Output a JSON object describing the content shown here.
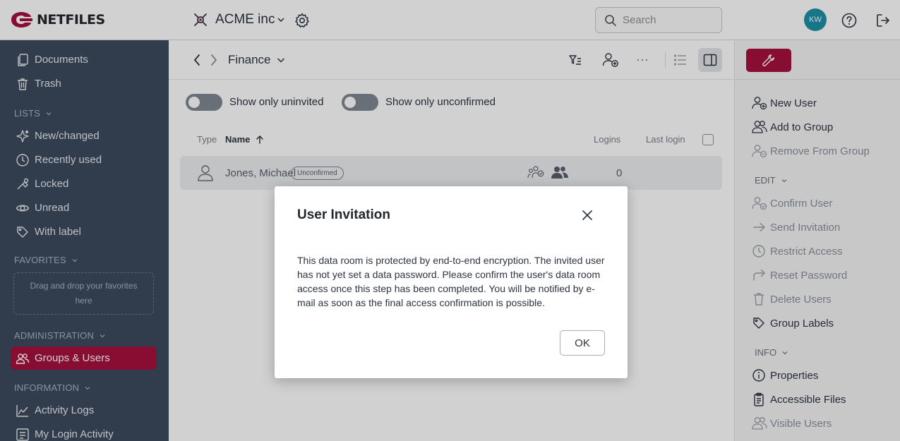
{
  "app": {
    "brand": "NETFILES",
    "workspace": "ACME inc",
    "brand_color": "#a7103f"
  },
  "search": {
    "placeholder": "Search"
  },
  "user": {
    "initials": "KW"
  },
  "sidebar": {
    "items_top": [
      {
        "label": "Documents",
        "icon": "documents-icon"
      },
      {
        "label": "Trash",
        "icon": "trash-icon"
      }
    ],
    "lists_title": "LISTS",
    "lists": [
      {
        "label": "New/changed",
        "icon": "sparkle-icon"
      },
      {
        "label": "Recently used",
        "icon": "clock-icon"
      },
      {
        "label": "Locked",
        "icon": "lock-icon"
      },
      {
        "label": "Unread",
        "icon": "eye-icon"
      },
      {
        "label": "With label",
        "icon": "tag-icon"
      }
    ],
    "favorites_title": "FAVORITES",
    "favorites_placeholder": "Drag and drop your favorites here",
    "administration_title": "ADMINISTRATION",
    "administration": [
      {
        "label": "Groups & Users",
        "icon": "users-icon",
        "active": true
      }
    ],
    "information_title": "INFORMATION",
    "information": [
      {
        "label": "Activity Logs",
        "icon": "chart-icon"
      },
      {
        "label": "My Login Activity",
        "icon": "list-icon"
      }
    ]
  },
  "main": {
    "breadcrumb": "Finance",
    "filters": [
      {
        "label": "Show only uninvited",
        "on": false
      },
      {
        "label": "Show only unconfirmed",
        "on": false
      }
    ],
    "columns": {
      "type": "Type",
      "name": "Name",
      "logins": "Logins",
      "last_login": "Last login"
    },
    "rows": [
      {
        "name": "Jones, Michael",
        "status": "Unconfirmed",
        "logins": "0",
        "last_login": ""
      }
    ]
  },
  "right_panel": {
    "actions": [
      {
        "label": "New User",
        "icon": "add-user-icon",
        "enabled": true
      },
      {
        "label": "Add to Group",
        "icon": "users-icon",
        "enabled": true
      },
      {
        "label": "Remove From Group",
        "icon": "remove-group-icon",
        "enabled": false
      }
    ],
    "edit_title": "EDIT",
    "edit": [
      {
        "label": "Confirm User",
        "icon": "confirm-user-icon",
        "enabled": false
      },
      {
        "label": "Send Invitation",
        "icon": "arrow-right-icon",
        "enabled": false
      },
      {
        "label": "Restrict Access",
        "icon": "clock-icon",
        "enabled": false
      },
      {
        "label": "Reset Password",
        "icon": "share-arrow-icon",
        "enabled": false
      },
      {
        "label": "Delete Users",
        "icon": "trash-icon",
        "enabled": false
      },
      {
        "label": "Group Labels",
        "icon": "tag-icon",
        "enabled": true
      }
    ],
    "info_title": "INFO",
    "info": [
      {
        "label": "Properties",
        "icon": "info-icon",
        "enabled": true
      },
      {
        "label": "Accessible Files",
        "icon": "clipboard-icon",
        "enabled": true
      },
      {
        "label": "Visible Users",
        "icon": "users-icon",
        "enabled": false
      }
    ]
  },
  "dialog": {
    "title": "User Invitation",
    "body": "This data room is protected by end-to-end encryption. The invited user has not yet set a data password. Please confirm the user's data room access once this step has been completed. You will be notified by e-mail as soon as the final access confirmation is possible.",
    "ok_label": "OK"
  }
}
